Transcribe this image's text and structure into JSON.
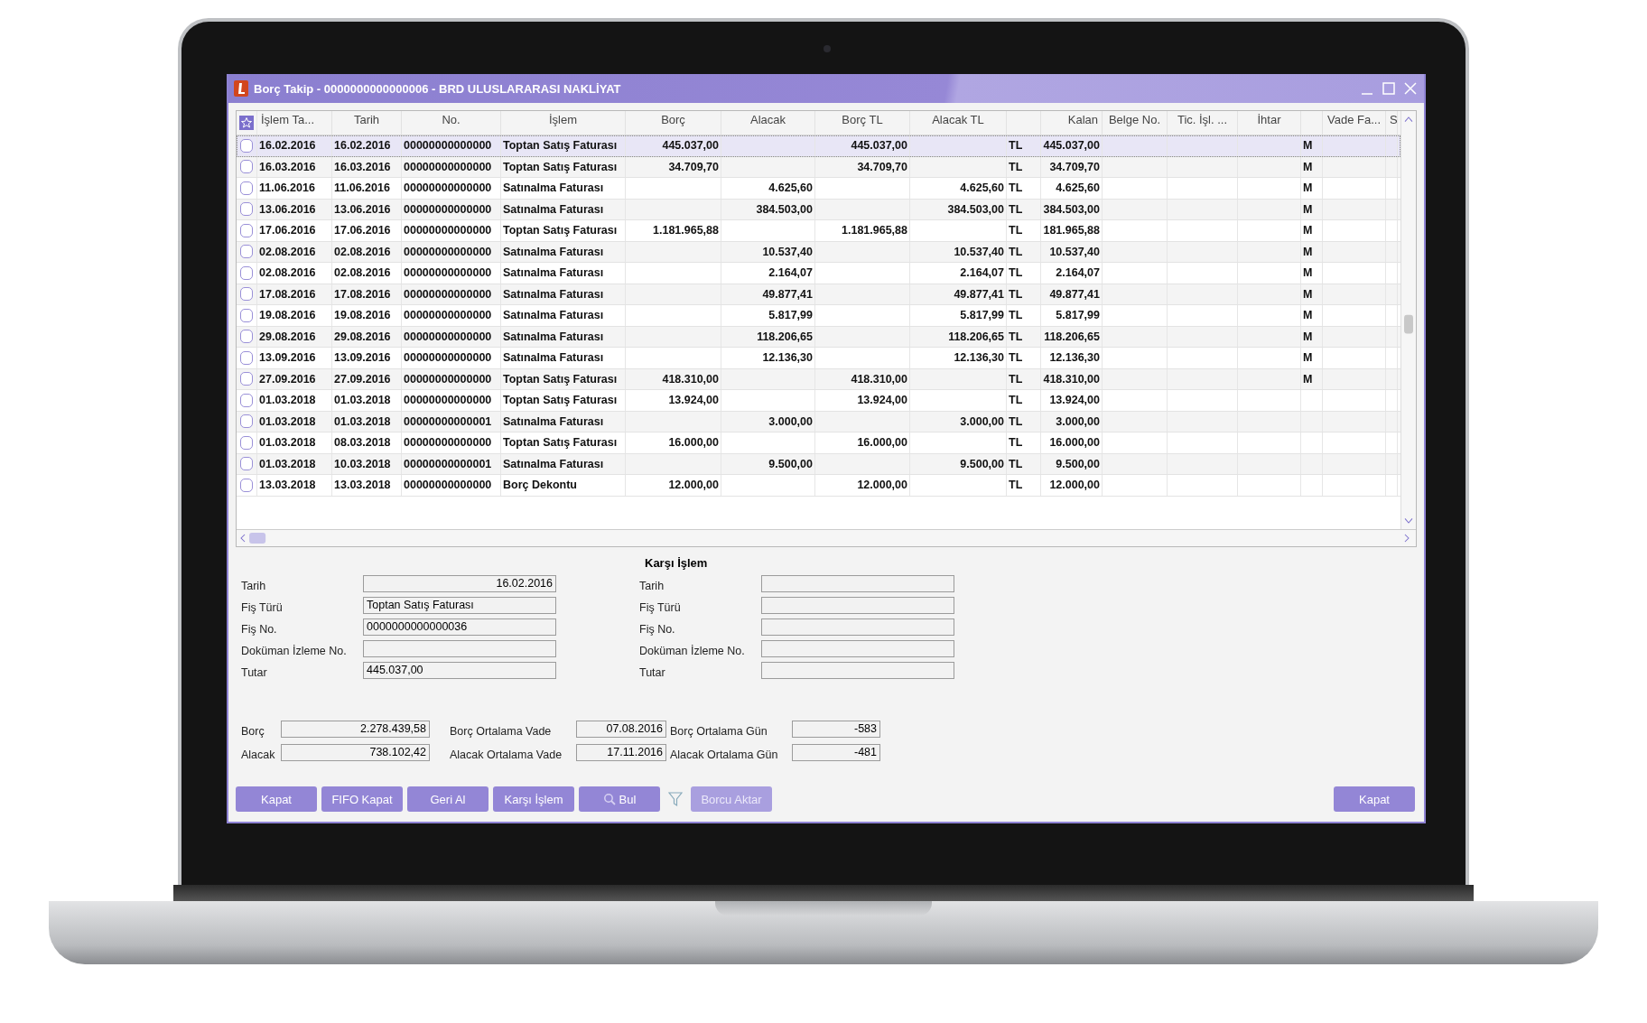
{
  "window": {
    "title": "Borç Takip - 0000000000000006 - BRD ULUSLARARASI NAKLİYAT"
  },
  "table": {
    "columns": [
      {
        "label": "İşlem Ta..."
      },
      {
        "label": "Tarih"
      },
      {
        "label": "No."
      },
      {
        "label": "İşlem"
      },
      {
        "label": "Borç"
      },
      {
        "label": "Alacak"
      },
      {
        "label": "Borç TL"
      },
      {
        "label": "Alacak TL"
      },
      {},
      {
        "label": "Kalan"
      },
      {
        "label": "Belge No."
      },
      {
        "label": "Tic. İşl. ..."
      },
      {
        "label": "İhtar"
      },
      {},
      {
        "label": "Vade Fa..."
      },
      {
        "label": "S"
      }
    ],
    "rows": [
      {
        "selected": true,
        "checked": false,
        "cells": [
          "16.02.2016",
          "16.02.2016",
          "00000000000000",
          "Toptan Satış Faturası",
          "445.037,00",
          null,
          "445.037,00",
          null,
          "TL",
          "445.037,00",
          null,
          null,
          null,
          "M",
          null,
          null
        ]
      },
      {
        "selected": false,
        "checked": false,
        "cells": [
          "16.03.2016",
          "16.03.2016",
          "00000000000000",
          "Toptan Satış Faturası",
          "34.709,70",
          null,
          "34.709,70",
          null,
          "TL",
          "34.709,70",
          null,
          null,
          null,
          "M",
          null,
          null
        ]
      },
      {
        "selected": false,
        "checked": false,
        "cells": [
          "11.06.2016",
          "11.06.2016",
          "00000000000000",
          "Satınalma Faturası",
          null,
          "4.625,60",
          null,
          "4.625,60",
          "TL",
          "4.625,60",
          null,
          null,
          null,
          "M",
          null,
          null
        ]
      },
      {
        "selected": false,
        "checked": false,
        "cells": [
          "13.06.2016",
          "13.06.2016",
          "00000000000000",
          "Satınalma Faturası",
          null,
          "384.503,00",
          null,
          "384.503,00",
          "TL",
          "384.503,00",
          null,
          null,
          null,
          "M",
          null,
          null
        ]
      },
      {
        "selected": false,
        "checked": false,
        "cells": [
          "17.06.2016",
          "17.06.2016",
          "00000000000000",
          "Toptan Satış Faturası",
          "1.181.965,88",
          null,
          "1.181.965,88",
          null,
          "TL",
          "181.965,88",
          null,
          null,
          null,
          "M",
          null,
          null
        ]
      },
      {
        "selected": false,
        "checked": false,
        "cells": [
          "02.08.2016",
          "02.08.2016",
          "00000000000000",
          "Satınalma Faturası",
          null,
          "10.537,40",
          null,
          "10.537,40",
          "TL",
          "10.537,40",
          null,
          null,
          null,
          "M",
          null,
          null
        ]
      },
      {
        "selected": false,
        "checked": false,
        "cells": [
          "02.08.2016",
          "02.08.2016",
          "00000000000000",
          "Satınalma Faturası",
          null,
          "2.164,07",
          null,
          "2.164,07",
          "TL",
          "2.164,07",
          null,
          null,
          null,
          "M",
          null,
          null
        ]
      },
      {
        "selected": false,
        "checked": false,
        "cells": [
          "17.08.2016",
          "17.08.2016",
          "00000000000000",
          "Satınalma Faturası",
          null,
          "49.877,41",
          null,
          "49.877,41",
          "TL",
          "49.877,41",
          null,
          null,
          null,
          "M",
          null,
          null
        ]
      },
      {
        "selected": false,
        "checked": false,
        "cells": [
          "19.08.2016",
          "19.08.2016",
          "00000000000000",
          "Satınalma Faturası",
          null,
          "5.817,99",
          null,
          "5.817,99",
          "TL",
          "5.817,99",
          null,
          null,
          null,
          "M",
          null,
          null
        ]
      },
      {
        "selected": false,
        "checked": false,
        "cells": [
          "29.08.2016",
          "29.08.2016",
          "00000000000000",
          "Satınalma Faturası",
          null,
          "118.206,65",
          null,
          "118.206,65",
          "TL",
          "118.206,65",
          null,
          null,
          null,
          "M",
          null,
          null
        ]
      },
      {
        "selected": false,
        "checked": false,
        "cells": [
          "13.09.2016",
          "13.09.2016",
          "00000000000000",
          "Satınalma Faturası",
          null,
          "12.136,30",
          null,
          "12.136,30",
          "TL",
          "12.136,30",
          null,
          null,
          null,
          "M",
          null,
          null
        ]
      },
      {
        "selected": false,
        "checked": false,
        "cells": [
          "27.09.2016",
          "27.09.2016",
          "00000000000000",
          "Toptan Satış Faturası",
          "418.310,00",
          null,
          "418.310,00",
          null,
          "TL",
          "418.310,00",
          null,
          null,
          null,
          "M",
          null,
          null
        ]
      },
      {
        "selected": false,
        "checked": false,
        "cells": [
          "01.03.2018",
          "01.03.2018",
          "00000000000000",
          "Toptan Satış Faturası",
          "13.924,00",
          null,
          "13.924,00",
          null,
          "TL",
          "13.924,00",
          null,
          null,
          null,
          null,
          null,
          null
        ]
      },
      {
        "selected": false,
        "checked": false,
        "cells": [
          "01.03.2018",
          "01.03.2018",
          "00000000000001",
          "Satınalma Faturası",
          null,
          "3.000,00",
          null,
          "3.000,00",
          "TL",
          "3.000,00",
          null,
          null,
          null,
          null,
          null,
          null
        ]
      },
      {
        "selected": false,
        "checked": false,
        "cells": [
          "01.03.2018",
          "08.03.2018",
          "00000000000000",
          "Toptan Satış Faturası",
          "16.000,00",
          null,
          "16.000,00",
          null,
          "TL",
          "16.000,00",
          null,
          null,
          null,
          null,
          null,
          null
        ]
      },
      {
        "selected": false,
        "checked": false,
        "cells": [
          "01.03.2018",
          "10.03.2018",
          "00000000000001",
          "Satınalma Faturası",
          null,
          "9.500,00",
          null,
          "9.500,00",
          "TL",
          "9.500,00",
          null,
          null,
          null,
          null,
          null,
          null
        ]
      },
      {
        "selected": false,
        "checked": false,
        "cells": [
          "13.03.2018",
          "13.03.2018",
          "00000000000000",
          "Borç Dekontu",
          "12.000,00",
          null,
          "12.000,00",
          null,
          "TL",
          "12.000,00",
          null,
          null,
          null,
          null,
          null,
          null
        ]
      }
    ]
  },
  "details": {
    "fields": [
      {
        "label": "Tarih",
        "value": "16.02.2016"
      },
      {
        "label": "Fiş Türü",
        "value": "Toptan Satış Faturası"
      },
      {
        "label": "Fiş No.",
        "value": "0000000000000036"
      },
      {
        "label": "Doküman İzleme No."
      },
      {
        "label": "Tutar",
        "value": "445.037,00"
      }
    ]
  },
  "counter_transaction": {
    "title": "Karşı İşlem",
    "fields": [
      {
        "label": "Tarih"
      },
      {
        "label": "Fiş Türü"
      },
      {
        "label": "Fiş No."
      },
      {
        "label": "Doküman İzleme No."
      },
      {
        "label": "Tutar"
      }
    ]
  },
  "summary": [
    [
      {
        "label": "Borç",
        "value": "2.278.439,58"
      },
      {
        "label": "Borç Ortalama Vade",
        "value": "07.08.2016"
      },
      {
        "label": "Borç Ortalama Gün",
        "value": "-583"
      }
    ],
    [
      {
        "label": "Alacak",
        "value": "738.102,42"
      },
      {
        "label": "Alacak Ortalama Vade",
        "value": "17.11.2016"
      },
      {
        "label": "Alacak Ortalama Gün",
        "value": "-481"
      }
    ]
  ],
  "buttons": [
    {
      "kind": "button",
      "label": "Kapat",
      "disabled": false
    },
    {
      "kind": "button",
      "label": "FIFO Kapat",
      "disabled": false
    },
    {
      "kind": "button",
      "label": "Geri Al",
      "disabled": false
    },
    {
      "kind": "button",
      "label": "Karşı İşlem",
      "disabled": false
    },
    {
      "kind": "search",
      "label": "Bul",
      "disabled": false
    },
    {
      "kind": "filter"
    },
    {
      "kind": "button",
      "label": "Borcu Aktar",
      "disabled": true
    },
    {
      "kind": "end",
      "label": "Kapat",
      "disabled": false
    }
  ]
}
